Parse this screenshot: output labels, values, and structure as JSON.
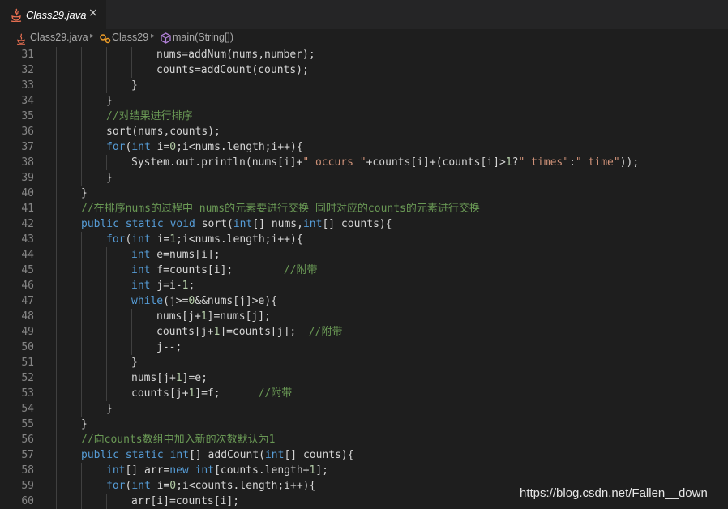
{
  "tab": {
    "label": "Class29.java",
    "close": "×"
  },
  "breadcrumb": {
    "file": "Class29.java",
    "class": "Class29",
    "method": "main(String[])"
  },
  "watermark": "https://blog.csdn.net/Fallen__down",
  "lines": [
    {
      "n": "31",
      "indent": 4,
      "toks": [
        [
          "nums=addNum(nums,number);",
          "p"
        ]
      ]
    },
    {
      "n": "32",
      "indent": 4,
      "toks": [
        [
          "counts=addCount(counts);",
          "p"
        ]
      ]
    },
    {
      "n": "33",
      "indent": 3,
      "toks": [
        [
          "}",
          "p"
        ]
      ]
    },
    {
      "n": "34",
      "indent": 2,
      "toks": [
        [
          "}",
          "p"
        ]
      ]
    },
    {
      "n": "35",
      "indent": 2,
      "toks": [
        [
          "//对结果进行排序",
          "c"
        ]
      ]
    },
    {
      "n": "36",
      "indent": 2,
      "toks": [
        [
          "sort(nums,counts);",
          "p"
        ]
      ]
    },
    {
      "n": "37",
      "indent": 2,
      "toks": [
        [
          "for",
          "k"
        ],
        [
          "(",
          "p"
        ],
        [
          "int",
          "t"
        ],
        [
          " i=",
          "p"
        ],
        [
          "0",
          "n"
        ],
        [
          ";i<nums.length;i++){",
          "p"
        ]
      ]
    },
    {
      "n": "38",
      "indent": 3,
      "toks": [
        [
          "System.out.println(nums[i]+",
          "p"
        ],
        [
          "\" occurs \"",
          "s"
        ],
        [
          "+counts[i]+(counts[i]>",
          "p"
        ],
        [
          "1",
          "n"
        ],
        [
          "?",
          "p"
        ],
        [
          "\" times\"",
          "s"
        ],
        [
          ":",
          "p"
        ],
        [
          "\" time\"",
          "s"
        ],
        [
          "));",
          "p"
        ]
      ]
    },
    {
      "n": "39",
      "indent": 2,
      "toks": [
        [
          "}",
          "p"
        ]
      ]
    },
    {
      "n": "40",
      "indent": 1,
      "toks": [
        [
          "}",
          "p"
        ]
      ]
    },
    {
      "n": "41",
      "indent": 1,
      "toks": [
        [
          "//在排序nums的过程中 nums的元素要进行交换 同时对应的counts的元素进行交换",
          "c"
        ]
      ]
    },
    {
      "n": "42",
      "indent": 1,
      "toks": [
        [
          "public static void",
          "k"
        ],
        [
          " sort(",
          "p"
        ],
        [
          "int",
          "t"
        ],
        [
          "[] nums,",
          "p"
        ],
        [
          "int",
          "t"
        ],
        [
          "[] counts){",
          "p"
        ]
      ]
    },
    {
      "n": "43",
      "indent": 2,
      "toks": [
        [
          "for",
          "k"
        ],
        [
          "(",
          "p"
        ],
        [
          "int",
          "t"
        ],
        [
          " i=",
          "p"
        ],
        [
          "1",
          "n"
        ],
        [
          ";i<nums.length;i++){",
          "p"
        ]
      ]
    },
    {
      "n": "44",
      "indent": 3,
      "toks": [
        [
          "int",
          "t"
        ],
        [
          " e=nums[i];",
          "p"
        ]
      ]
    },
    {
      "n": "45",
      "indent": 3,
      "toks": [
        [
          "int",
          "t"
        ],
        [
          " f=counts[i];        ",
          "p"
        ],
        [
          "//附带",
          "c"
        ]
      ]
    },
    {
      "n": "46",
      "indent": 3,
      "toks": [
        [
          "int",
          "t"
        ],
        [
          " j=i-",
          "p"
        ],
        [
          "1",
          "n"
        ],
        [
          ";",
          "p"
        ]
      ]
    },
    {
      "n": "47",
      "indent": 3,
      "toks": [
        [
          "while",
          "k"
        ],
        [
          "(j>=",
          "p"
        ],
        [
          "0",
          "n"
        ],
        [
          "&&nums[j]>e){",
          "p"
        ]
      ]
    },
    {
      "n": "48",
      "indent": 4,
      "toks": [
        [
          "nums[j+",
          "p"
        ],
        [
          "1",
          "n"
        ],
        [
          "]=nums[j];",
          "p"
        ]
      ]
    },
    {
      "n": "49",
      "indent": 4,
      "toks": [
        [
          "counts[j+",
          "p"
        ],
        [
          "1",
          "n"
        ],
        [
          "]=counts[j];  ",
          "p"
        ],
        [
          "//附带",
          "c"
        ]
      ]
    },
    {
      "n": "50",
      "indent": 4,
      "toks": [
        [
          "j--;",
          "p"
        ]
      ]
    },
    {
      "n": "51",
      "indent": 3,
      "toks": [
        [
          "}",
          "p"
        ]
      ]
    },
    {
      "n": "52",
      "indent": 3,
      "toks": [
        [
          "nums[j+",
          "p"
        ],
        [
          "1",
          "n"
        ],
        [
          "]=e;",
          "p"
        ]
      ]
    },
    {
      "n": "53",
      "indent": 3,
      "toks": [
        [
          "counts[j+",
          "p"
        ],
        [
          "1",
          "n"
        ],
        [
          "]=f;      ",
          "p"
        ],
        [
          "//附带",
          "c"
        ]
      ]
    },
    {
      "n": "54",
      "indent": 2,
      "toks": [
        [
          "}",
          "p"
        ]
      ]
    },
    {
      "n": "55",
      "indent": 1,
      "toks": [
        [
          "}",
          "p"
        ]
      ]
    },
    {
      "n": "56",
      "indent": 1,
      "toks": [
        [
          "//向counts数组中加入新的次数默认为1",
          "c"
        ]
      ]
    },
    {
      "n": "57",
      "indent": 1,
      "toks": [
        [
          "public static",
          "k"
        ],
        [
          " ",
          "p"
        ],
        [
          "int",
          "t"
        ],
        [
          "[] addCount(",
          "p"
        ],
        [
          "int",
          "t"
        ],
        [
          "[] counts){",
          "p"
        ]
      ]
    },
    {
      "n": "58",
      "indent": 2,
      "toks": [
        [
          "int",
          "t"
        ],
        [
          "[] arr=",
          "p"
        ],
        [
          "new",
          "k"
        ],
        [
          " ",
          "p"
        ],
        [
          "int",
          "t"
        ],
        [
          "[counts.length+",
          "p"
        ],
        [
          "1",
          "n"
        ],
        [
          "];",
          "p"
        ]
      ]
    },
    {
      "n": "59",
      "indent": 2,
      "toks": [
        [
          "for",
          "k"
        ],
        [
          "(",
          "p"
        ],
        [
          "int",
          "t"
        ],
        [
          " i=",
          "p"
        ],
        [
          "0",
          "n"
        ],
        [
          ";i<counts.length;i++){",
          "p"
        ]
      ]
    },
    {
      "n": "60",
      "indent": 3,
      "toks": [
        [
          "arr[i]=counts[i];",
          "p"
        ]
      ]
    }
  ]
}
